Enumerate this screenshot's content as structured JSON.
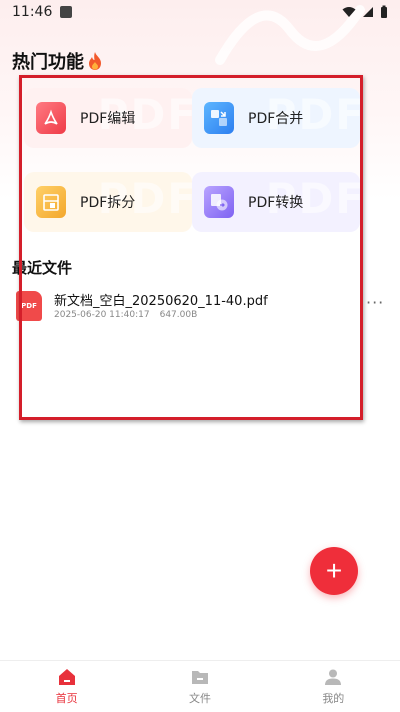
{
  "status_bar": {
    "time": "11:46"
  },
  "hot_features": {
    "title": "热门功能",
    "tiles": [
      {
        "label": "PDF编辑",
        "watermark": "PDF"
      },
      {
        "label": "PDF合并",
        "watermark": "PDF"
      },
      {
        "label": "PDF拆分",
        "watermark": "PDF"
      },
      {
        "label": "PDF转换",
        "watermark": "PDF"
      }
    ]
  },
  "recent_files": {
    "title": "最近文件",
    "items": [
      {
        "icon_text": "PDF",
        "name": "新文档_空白_20250620_11-40.pdf",
        "datetime": "2025-06-20 11:40:17",
        "size": "647.00B"
      }
    ]
  },
  "fab": {
    "symbol": "+"
  },
  "bottom_nav": {
    "items": [
      {
        "label": "首页"
      },
      {
        "label": "文件"
      },
      {
        "label": "我的"
      }
    ]
  },
  "colors": {
    "accent": "#e8313b",
    "highlight_border": "#d41e2a"
  }
}
